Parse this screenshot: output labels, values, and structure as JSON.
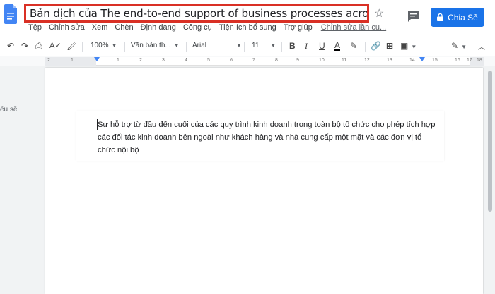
{
  "document": {
    "title": "Bản dịch của The end-to-end support of business processes across the wh...",
    "share_label": "Chia Sẻ"
  },
  "menu": {
    "items": [
      "Tệp",
      "Chỉnh sửa",
      "Xem",
      "Chèn",
      "Định dạng",
      "Công cụ",
      "Tiện ích bổ sung",
      "Trợ giúp"
    ],
    "last_edit": "Chỉnh sửa lần cu..."
  },
  "toolbar": {
    "zoom": "100%",
    "style": "Văn bản th...",
    "font": "Arial",
    "font_size": "11"
  },
  "ruler": {
    "numbers": [
      "2",
      "1",
      "1",
      "2",
      "3",
      "4",
      "5",
      "6",
      "7",
      "8",
      "9",
      "10",
      "11",
      "12",
      "13",
      "14",
      "15",
      "16",
      "17",
      "18"
    ]
  },
  "sidebar": {
    "fragment": "ều sẽ"
  },
  "body": {
    "paragraph": "Sự hỗ trợ từ đầu đến cuối của các quy trình kinh doanh trong toàn bộ tổ chức cho phép tích hợp các đối tác kinh doanh bên ngoài như khách hàng và nhà cung cấp một mặt và các đơn vị tổ chức nội bộ"
  },
  "colors": {
    "accent": "#1a73e8",
    "highlight_border": "#d93025",
    "docs_blue": "#4285f4"
  }
}
